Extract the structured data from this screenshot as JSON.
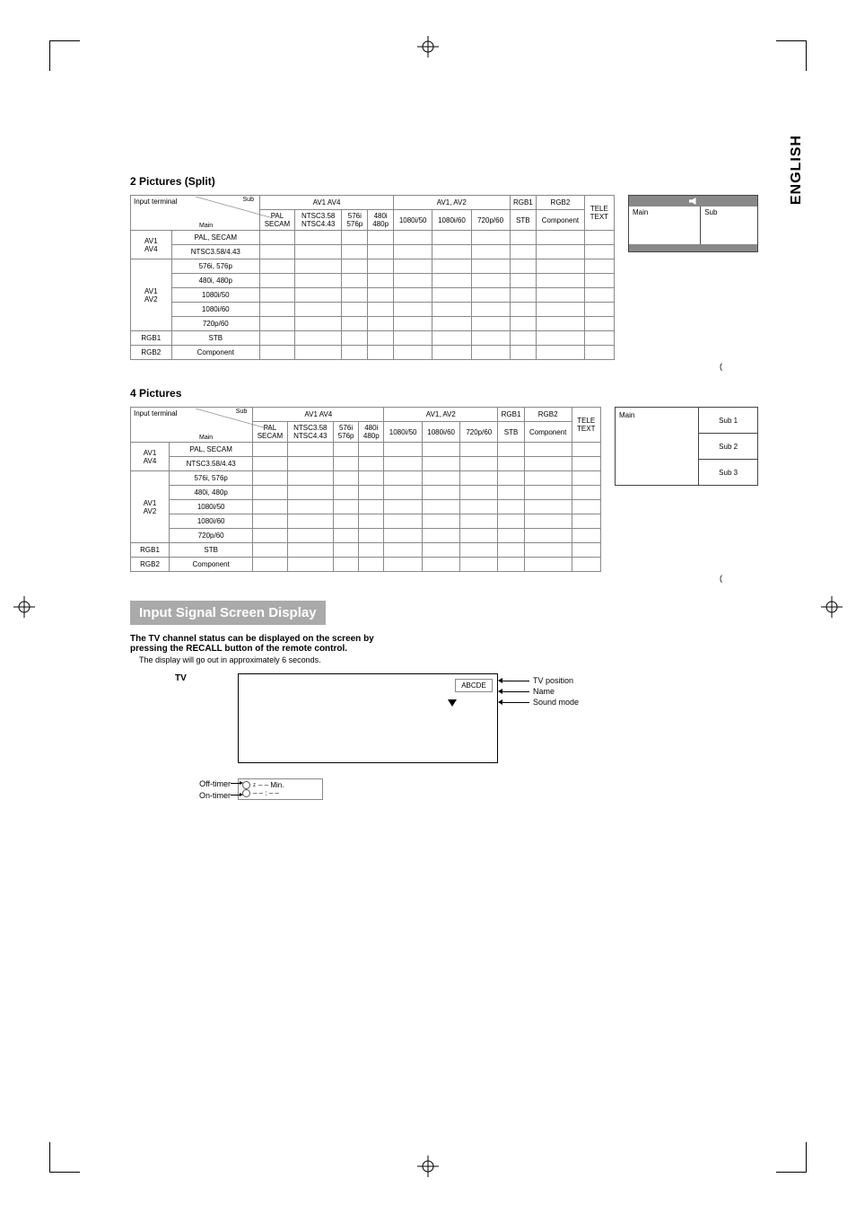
{
  "lang_side": "ENGLISH",
  "sec1": {
    "title": "2 Pictures (Split)"
  },
  "sec2": {
    "title": "4 Pictures"
  },
  "table": {
    "input_terminal": "Input terminal",
    "sub": "Sub",
    "main": "Main",
    "av1av4": "AV1   AV4",
    "pal_secam_h": "PAL\nSECAM",
    "ntsc_h": "NTSC3.58\nNTSC4.43",
    "c576i": "576i\n576p",
    "c480i": "480i\n480p",
    "av1av2": "AV1, AV2",
    "c1080i50": "1080i/50",
    "c1080i60": "1080i/60",
    "c720p60": "720p/60",
    "rgb1": "RGB1",
    "stb": "STB",
    "rgb2": "RGB2",
    "component": "Component",
    "teletext": "TELE\nTEXT",
    "rows_left_group1": "AV1\nAV4",
    "rows_left_group2": "AV1\nAV2",
    "r_palsecam": "PAL, SECAM",
    "r_ntsc": "NTSC3.58/4.43",
    "r_576": "576i, 576p",
    "r_480": "480i, 480p",
    "r_1080i50": "1080i/50",
    "r_1080i60": "1080i/60",
    "r_720p60": "720p/60",
    "r_rgb1": "RGB1",
    "r_stb": "STB",
    "r_rgb2": "RGB2",
    "r_comp": "Component"
  },
  "paren": "(",
  "mini": {
    "main": "Main",
    "sub": "Sub",
    "sub1": "Sub 1",
    "sub2": "Sub 2",
    "sub3": "Sub 3"
  },
  "sec3": {
    "bar": "Input Signal Screen Display",
    "line1": "The TV channel status can be displayed on the screen by",
    "line2": "pressing the RECALL button of the remote control.",
    "line3": "The display will go out in approximately 6 seconds.",
    "tv": "TV",
    "abcde": "ABCDE",
    "tvposition": "TV position",
    "name": "Name",
    "soundmode": "Sound mode",
    "offtimer": "Off-timer",
    "ontimer": "On-timer",
    "min": "– – Min.",
    "time": "– – : – –"
  }
}
